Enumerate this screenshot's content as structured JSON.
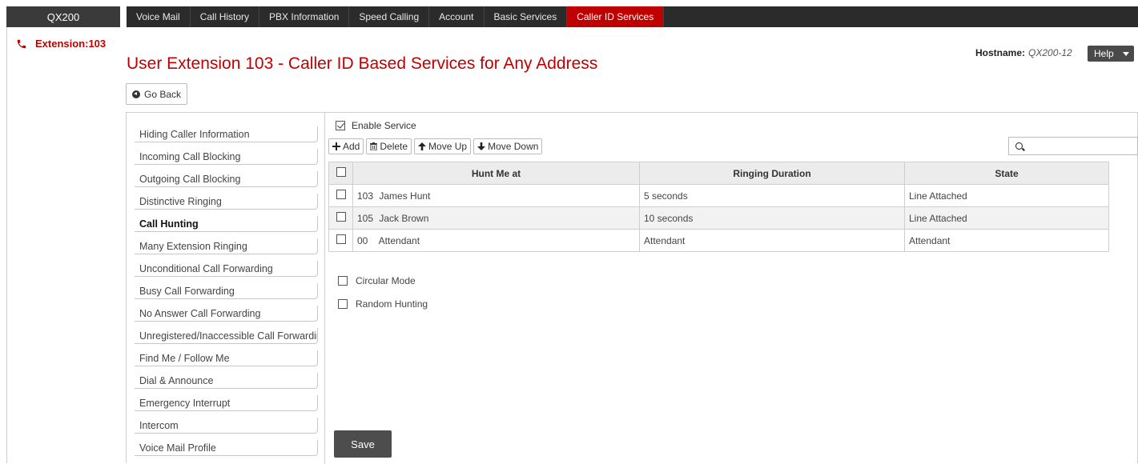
{
  "brand": "QX200",
  "nav": [
    {
      "label": "Voice Mail",
      "active": false
    },
    {
      "label": "Call History",
      "active": false
    },
    {
      "label": "PBX Information",
      "active": false
    },
    {
      "label": "Speed Calling",
      "active": false
    },
    {
      "label": "Account",
      "active": false
    },
    {
      "label": "Basic Services",
      "active": false
    },
    {
      "label": "Caller ID Services",
      "active": true
    }
  ],
  "extension": "Extension:103",
  "page_title": "User Extension 103 - Caller ID Based Services for Any Address",
  "hostname": {
    "label": "Hostname:",
    "value": "QX200-12"
  },
  "help_label": "Help",
  "go_back_label": "Go Back",
  "menu": [
    {
      "label": "Hiding Caller Information",
      "active": false
    },
    {
      "label": "Incoming Call Blocking",
      "active": false
    },
    {
      "label": "Outgoing Call Blocking",
      "active": false
    },
    {
      "label": "Distinctive Ringing",
      "active": false
    },
    {
      "label": "Call Hunting",
      "active": true
    },
    {
      "label": "Many Extension Ringing",
      "active": false
    },
    {
      "label": "Unconditional Call Forwarding",
      "active": false
    },
    {
      "label": "Busy Call Forwarding",
      "active": false
    },
    {
      "label": "No Answer Call Forwarding",
      "active": false
    },
    {
      "label": "Unregistered/Inaccessible Call Forwarding",
      "active": false
    },
    {
      "label": "Find Me / Follow Me",
      "active": false
    },
    {
      "label": "Dial & Announce",
      "active": false
    },
    {
      "label": "Emergency Interrupt",
      "active": false
    },
    {
      "label": "Intercom",
      "active": false
    },
    {
      "label": "Voice Mail Profile",
      "active": false
    }
  ],
  "enable_service": {
    "label": "Enable Service",
    "checked": true
  },
  "toolbar": {
    "add": "Add",
    "delete": "Delete",
    "move_up": "Move Up",
    "move_down": "Move Down"
  },
  "table": {
    "headers": [
      "Hunt Me at",
      "Ringing Duration",
      "State"
    ],
    "rows": [
      {
        "number": "103",
        "name": "James Hunt",
        "duration": "5 seconds",
        "state": "Line Attached"
      },
      {
        "number": "105",
        "name": "Jack Brown",
        "duration": "10 seconds",
        "state": "Line Attached"
      },
      {
        "number": "00",
        "name": "Attendant",
        "duration": "Attendant",
        "state": "Attendant"
      }
    ]
  },
  "options": {
    "circular_mode": {
      "label": "Circular Mode",
      "checked": false
    },
    "random_hunting": {
      "label": "Random Hunting",
      "checked": false
    }
  },
  "save_label": "Save",
  "colors": {
    "accent": "#c00000",
    "nav_bg": "#2b2b2b"
  }
}
